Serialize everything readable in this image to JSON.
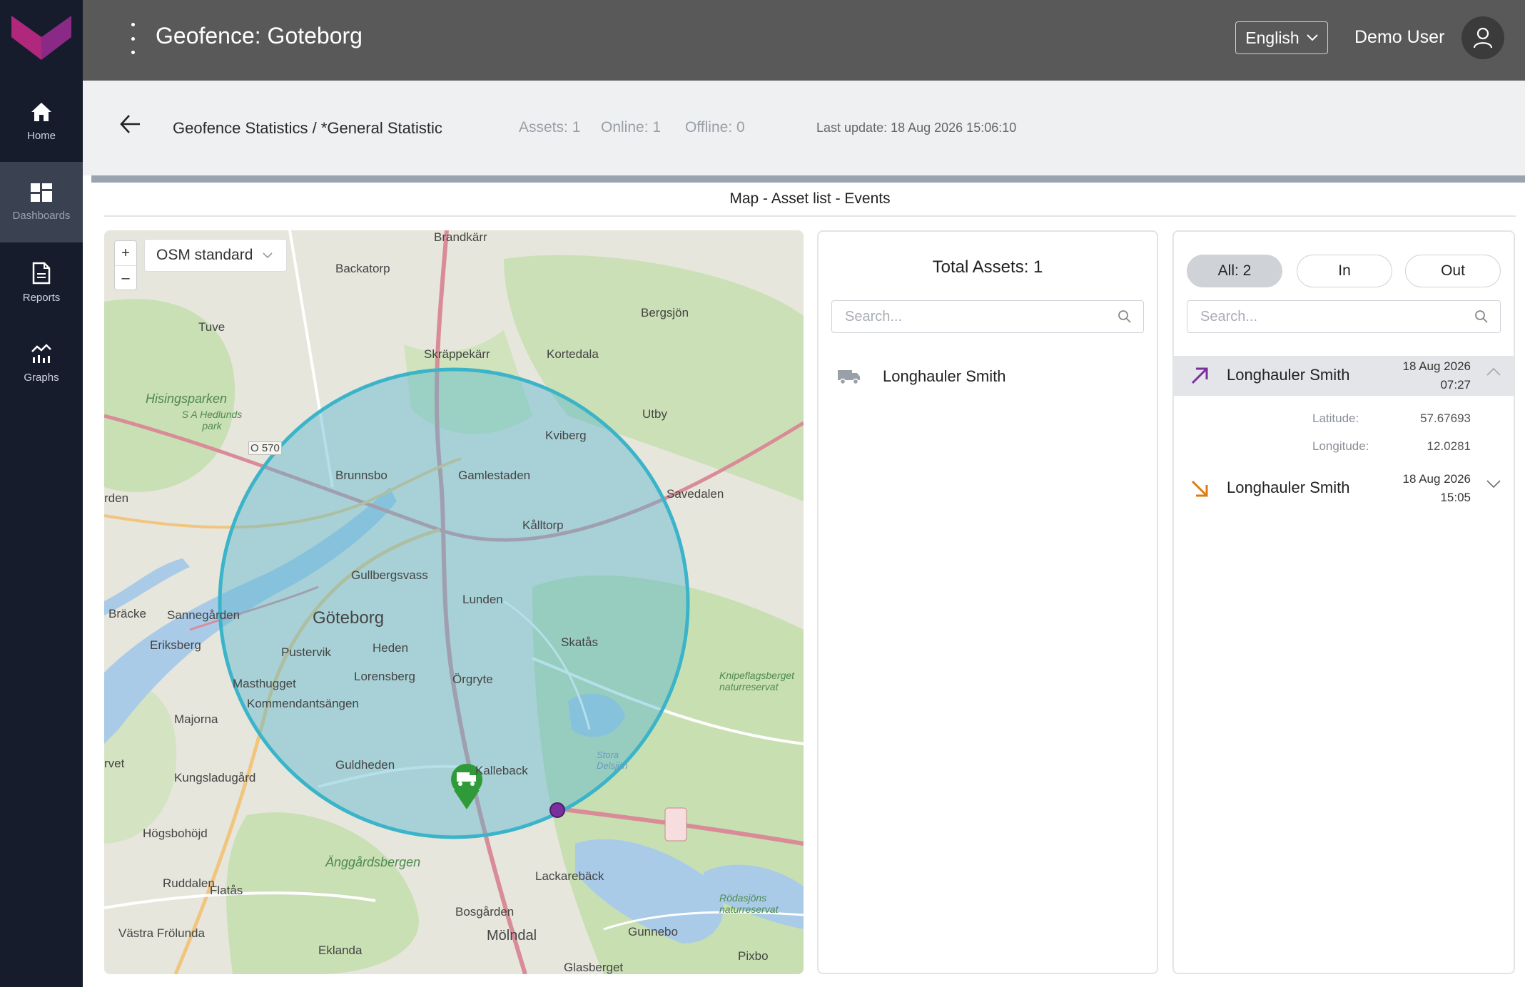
{
  "sidebar": {
    "items": [
      {
        "label": "Home",
        "icon": "home-icon"
      },
      {
        "label": "Dashboards",
        "icon": "dashboard-icon",
        "active": true
      },
      {
        "label": "Reports",
        "icon": "report-icon"
      },
      {
        "label": "Graphs",
        "icon": "graph-icon"
      }
    ]
  },
  "header": {
    "title": "Geofence: Goteborg",
    "language": "English",
    "user": "Demo User"
  },
  "subheader": {
    "breadcrumb": "Geofence Statistics / *General Statistic",
    "assets": "Assets: 1",
    "online": "Online: 1",
    "offline": "Offline: 0",
    "last_update": "Last update: 18 Aug 2026 15:06:10"
  },
  "section_title": "Map - Asset list - Events",
  "map": {
    "layer": "OSM standard",
    "zoom_in": "+",
    "zoom_out": "–",
    "labels": [
      "Brandkärr",
      "Backatorp",
      "Tuve",
      "Bergsjön",
      "Skräppekärr",
      "Kortedala",
      "Hisingsparken",
      "S A Hedlunds park",
      "O 570",
      "Utby",
      "Kviberg",
      "Brunnsbo",
      "Gamlestaden",
      "Savedalen",
      "rden",
      "Kålltorp",
      "Gullbergsvass",
      "Bräcke",
      "Sannegården",
      "Göteborg",
      "Lunden",
      "Eriksberg",
      "Pustervik",
      "Heden",
      "Skatås",
      "Lorensberg",
      "Örgryte",
      "Masthugget",
      "Kommendantsängen",
      "Majorna",
      "Kalleback",
      "Guldheden",
      "rvet",
      "Kungsladugård",
      "Högsbohöjd",
      "Änggårdsbergen",
      "Lackarebäck",
      "Ruddalen",
      "Flatås",
      "Bosgården",
      "Västra Frölunda",
      "Mölndal",
      "Gunnebo",
      "Eklanda",
      "Glasberget",
      "Pixbo",
      "Knipeflagsberget naturreservat",
      "Rödasjöns naturreservat",
      "Stora Delsjön"
    ]
  },
  "assets_panel": {
    "title": "Total Assets: 1",
    "search_placeholder": "Search...",
    "items": [
      {
        "name": "Longhauler Smith",
        "icon": "truck-icon"
      }
    ]
  },
  "events_panel": {
    "filters": {
      "all": "All: 2",
      "in": "In",
      "out": "Out"
    },
    "search_placeholder": "Search...",
    "events": [
      {
        "name": "Longhauler Smith",
        "direction": "in",
        "date": "18 Aug 2026",
        "time": "07:27",
        "expanded": true,
        "latitude_label": "Latitude:",
        "latitude": "57.67693",
        "longitude_label": "Longitude:",
        "longitude": "12.0281"
      },
      {
        "name": "Longhauler Smith",
        "direction": "out",
        "date": "18 Aug 2026",
        "time": "15:05",
        "expanded": false
      }
    ]
  },
  "colors": {
    "sidebar": "#161c2c",
    "topbar": "#595959",
    "accent": "#7b2a8c",
    "geofence": "#3bb4c9",
    "marker": "#2e9b38",
    "in_arrow": "#7a2fa0",
    "out_arrow": "#e07b12"
  }
}
